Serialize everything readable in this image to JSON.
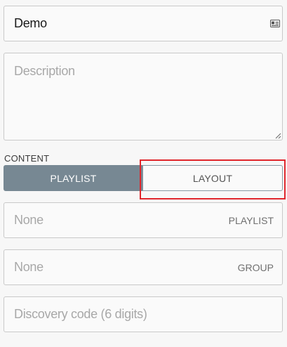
{
  "name_field": {
    "value": "Demo",
    "icon": "id-card-icon"
  },
  "description_field": {
    "placeholder": "Description"
  },
  "content": {
    "section_label": "CONTENT",
    "options": [
      {
        "label": "PLAYLIST",
        "selected": true
      },
      {
        "label": "LAYOUT",
        "selected": false
      }
    ]
  },
  "playlist_field": {
    "value": "None",
    "suffix": "PLAYLIST"
  },
  "group_field": {
    "value": "None",
    "suffix": "GROUP"
  },
  "discovery_field": {
    "placeholder": "Discovery code (6 digits)"
  },
  "colors": {
    "selected_segment": "#778893",
    "highlight_box": "#e0262c"
  }
}
